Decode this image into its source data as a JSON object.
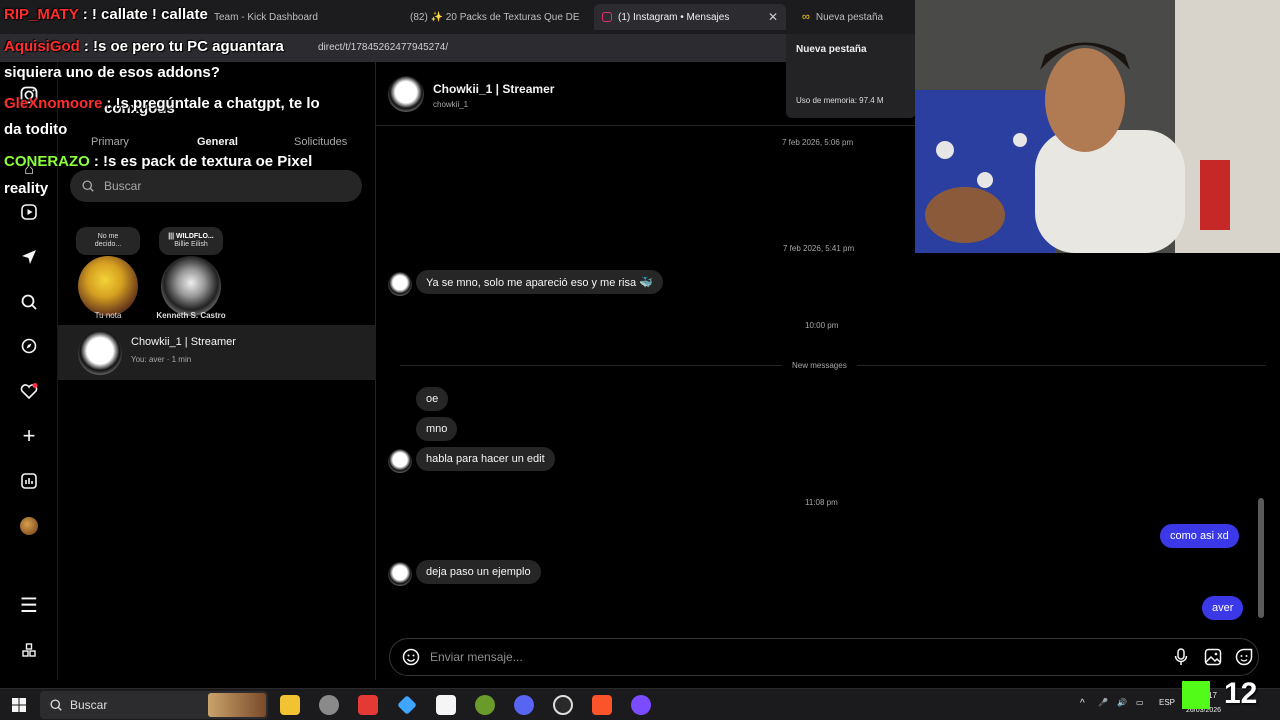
{
  "browser": {
    "tabs": [
      {
        "label": "Team - Kick Dashboard",
        "active": false
      },
      {
        "label": "(82) ✨ 20 Packs de Texturas Que DE",
        "active": false
      },
      {
        "label": "(1) Instagram • Mensajes",
        "active": true
      },
      {
        "label": "Nueva pestaña",
        "active": false
      }
    ],
    "address": "direct/t/17845262477945274/",
    "newtab_popup": {
      "title": "Nueva pestaña",
      "memory": "Uso de memoria: 97.4 M"
    }
  },
  "overlay_chat": [
    {
      "user": "RIP_MATY",
      "text": ": ! callate ! callate",
      "color": "#ff2d2d"
    },
    {
      "user": "AquisiGod",
      "text": ": !s oe pero tu PC aguantara",
      "color": "#ff2d2d"
    },
    {
      "user": "",
      "text": "siquiera uno de esos addons?",
      "color": "#ffffff"
    },
    {
      "user": "GleXnomoore",
      "text": ": !s pregúntale a chatgpt, te lo",
      "color": "#ff2d2d"
    },
    {
      "user": "",
      "text": "da todito",
      "color": "#ffffff"
    },
    {
      "user": "CONERAZO",
      "text": ": !s es pack de textura oe Pixel",
      "color": "#8cff3a"
    },
    {
      "user": "",
      "text": "reality",
      "color": "#ffffff"
    }
  ],
  "instagram": {
    "username": "conxgods",
    "list_tabs": [
      {
        "label": "Primary",
        "selected": false
      },
      {
        "label": "General",
        "selected": true
      },
      {
        "label": "Solicitudes",
        "selected": false
      }
    ],
    "search_placeholder": "Buscar",
    "notes": [
      {
        "bubble_line1": "No me",
        "bubble_line2": "decido...",
        "name": "Tu nota"
      },
      {
        "bubble_line1": "||| WILDFLO...",
        "bubble_line2": "Billie Eilish",
        "name": "Kenneth S. Castro"
      }
    ],
    "conversations": [
      {
        "name": "Chowkii_1 | Streamer",
        "preview": "You: aver · 1 min"
      }
    ],
    "chat": {
      "name": "Chowkii_1 | Streamer",
      "handle": "chowkii_1",
      "timestamps": [
        "7 feb 2026, 5:06 pm",
        "7 feb 2026, 5:41 pm",
        "10:00 pm",
        "11:08 pm"
      ],
      "new_messages_label": "New messages",
      "messages": [
        {
          "dir": "in",
          "text": "Ya se mno, solo me apareció eso y me risa 🐳"
        },
        {
          "dir": "in",
          "text": "oe"
        },
        {
          "dir": "in",
          "text": "mno"
        },
        {
          "dir": "in",
          "text": "habla para hacer un edit"
        },
        {
          "dir": "out",
          "text": "como asi xd"
        },
        {
          "dir": "in",
          "text": "deja paso un ejemplo"
        },
        {
          "dir": "out",
          "text": "aver"
        }
      ],
      "composer_placeholder": "Enviar mensaje..."
    }
  },
  "taskbar": {
    "search_label": "Buscar",
    "lang": "ESP",
    "time": "17",
    "date": "26/03/2026",
    "kick_count": "12"
  },
  "colors": {
    "outgoing_bubble": "#3b38e8",
    "incoming_bubble": "#262626",
    "kick_green": "#53fc18"
  }
}
